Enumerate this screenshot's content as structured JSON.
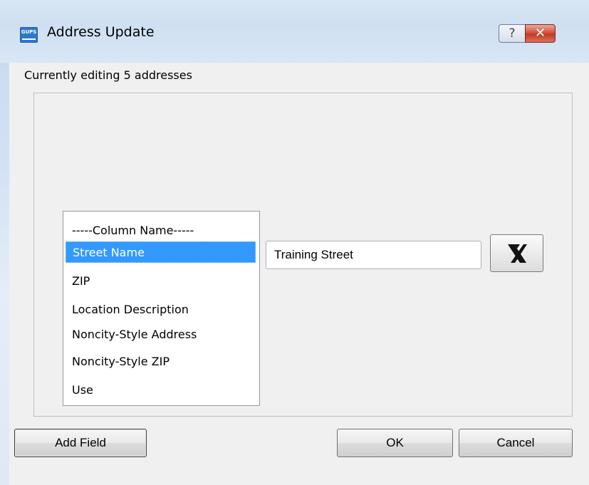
{
  "window": {
    "title": "Address Update",
    "icon_text": "GUPS",
    "help_symbol": "?",
    "close_symbol": "✕"
  },
  "subtitle": "Currently editing 5 addresses",
  "column_list": {
    "items": [
      {
        "label": "-----Column Name-----",
        "selected": false
      },
      {
        "label": "Street Name",
        "selected": true
      },
      {
        "label": "ZIP",
        "selected": false
      },
      {
        "label": "Location Description",
        "selected": false
      },
      {
        "label": "Noncity-Style Address",
        "selected": false
      },
      {
        "label": "Noncity-Style ZIP",
        "selected": false
      },
      {
        "label": "Use",
        "selected": false
      }
    ]
  },
  "value_input": {
    "value": "Training Street",
    "placeholder": ""
  },
  "buttons": {
    "add_field": "Add Field",
    "ok": "OK",
    "cancel": "Cancel",
    "remove_icon": "x-icon"
  },
  "colors": {
    "selection": "#3399ff",
    "close_button": "#c23a22",
    "dialog_background": "#f0f0f0"
  }
}
